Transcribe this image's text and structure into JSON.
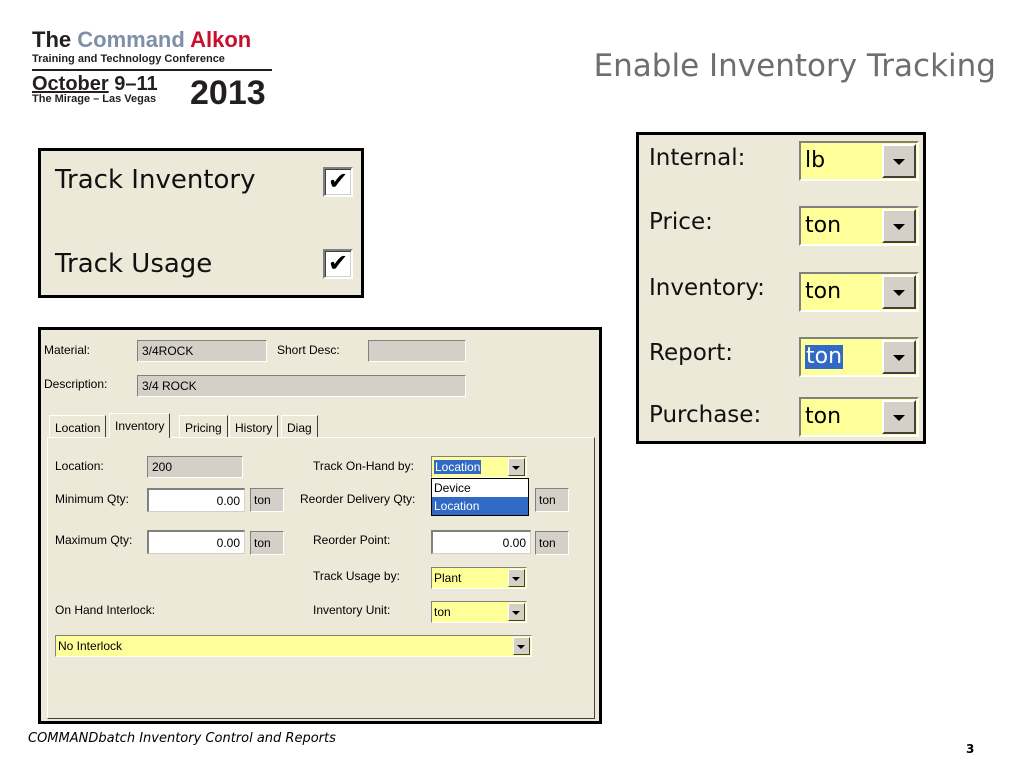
{
  "logo": {
    "line1_the": "The",
    "line1_command": "Command",
    "line1_alkon": "Alkon",
    "line2": "Training and Technology Conference",
    "date_month": "October",
    "date_days": "9–11",
    "venue": "The Mirage – Las Vegas",
    "year": "2013"
  },
  "slide_title": "Enable Inventory Tracking",
  "track_options": [
    {
      "label": "Track Inventory",
      "checked": true,
      "mark": "✔"
    },
    {
      "label": "Track Usage",
      "checked": true,
      "mark": "✔"
    }
  ],
  "units": [
    {
      "label": "Internal:",
      "value": "lb",
      "selected": false
    },
    {
      "label": "Price:",
      "value": "ton",
      "selected": false
    },
    {
      "label": "Inventory:",
      "value": "ton",
      "selected": false
    },
    {
      "label": "Report:",
      "value": "ton",
      "selected": true
    },
    {
      "label": "Purchase:",
      "value": "ton",
      "selected": false
    }
  ],
  "material_form": {
    "material_label": "Material:",
    "material_value": "3/4ROCK",
    "short_desc_label": "Short Desc:",
    "short_desc_value": "",
    "description_label": "Description:",
    "description_value": "3/4 ROCK",
    "tabs": [
      "Location",
      "Inventory",
      "Pricing",
      "History",
      "Diag"
    ],
    "active_tab": "Inventory",
    "location_label": "Location:",
    "location_value": "200",
    "min_qty_label": "Minimum Qty:",
    "min_qty_value": "0.00",
    "min_qty_unit": "ton",
    "max_qty_label": "Maximum Qty:",
    "max_qty_value": "0.00",
    "max_qty_unit": "ton",
    "track_onhand_label": "Track On-Hand by:",
    "track_onhand_value": "Location",
    "track_onhand_options": [
      "Device",
      "Location"
    ],
    "track_onhand_selected": "Location",
    "reorder_delivery_label": "Reorder Delivery Qty:",
    "reorder_delivery_unit": "ton",
    "reorder_point_label": "Reorder Point:",
    "reorder_point_value": "0.00",
    "reorder_point_unit": "ton",
    "track_usage_label": "Track Usage by:",
    "track_usage_value": "Plant",
    "inventory_unit_label": "Inventory Unit:",
    "inventory_unit_value": "ton",
    "onhand_interlock_label": "On Hand Interlock:",
    "onhand_interlock_value": "No Interlock"
  },
  "footer": "COMMANDbatch Inventory Control and Reports",
  "page_number": "3"
}
